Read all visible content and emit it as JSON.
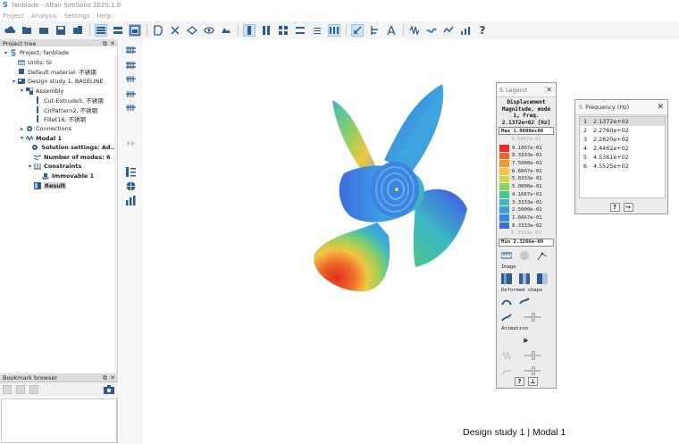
{
  "window": {
    "title": "fanblade - Altair SimSolid 2020.1.0"
  },
  "menu": [
    "Project",
    "Analysis",
    "Settings",
    "Help"
  ],
  "project_tree": {
    "title": "Project tree",
    "items": [
      {
        "label": "Project: fanblade",
        "level": 0,
        "arrow": "▾",
        "icon": "simsolid-icon",
        "bold": false
      },
      {
        "label": "Units: SI",
        "level": 1,
        "arrow": "",
        "icon": "units-icon",
        "bold": false
      },
      {
        "label": "Default material: 不锈钢",
        "level": 1,
        "arrow": "",
        "icon": "material-icon",
        "bold": false
      },
      {
        "label": "Design study 1, BASELINE",
        "level": 1,
        "arrow": "▾",
        "icon": "design-study-icon",
        "bold": false
      },
      {
        "label": "Assembly",
        "level": 2,
        "arrow": "▾",
        "icon": "assembly-icon",
        "bold": false
      },
      {
        "label": "Cut-Extrude5, 不锈钢",
        "level": 3,
        "arrow": "",
        "icon": "part-icon",
        "bold": false
      },
      {
        "label": "CirPattern2, 不锈钢",
        "level": 3,
        "arrow": "",
        "icon": "part-icon",
        "bold": false
      },
      {
        "label": "Fillet16, 不锈钢",
        "level": 3,
        "arrow": "",
        "icon": "part-icon",
        "bold": false
      },
      {
        "label": "Connections",
        "level": 2,
        "arrow": "▸",
        "icon": "connections-icon",
        "bold": false
      },
      {
        "label": "Modal 1",
        "level": 2,
        "arrow": "▾",
        "icon": "modal-icon",
        "bold": true
      },
      {
        "label": "Solution settings: Ad...",
        "level": 3,
        "arrow": "",
        "icon": "gear-icon",
        "bold": true
      },
      {
        "label": "Number of modes: 6",
        "level": 3,
        "arrow": "",
        "icon": "modes-icon",
        "bold": true
      },
      {
        "label": "Constraints",
        "level": 3,
        "arrow": "▾",
        "icon": "constraints-icon",
        "bold": true
      },
      {
        "label": "Immovable 1",
        "level": 4,
        "arrow": "",
        "icon": "immovable-icon",
        "bold": true
      },
      {
        "label": "Result",
        "level": 3,
        "arrow": "",
        "icon": "result-icon",
        "bold": true,
        "selected": true
      }
    ]
  },
  "bookmark": {
    "title": "Bookmark browser"
  },
  "legend": {
    "title": "Legend",
    "heading": [
      "Displacement",
      "Magnitude, mode",
      "1, Freq.",
      "2.1372e+02 [Hz]"
    ],
    "max_label": "Max 1.0000e+00",
    "top_faint": "9.1667e-01",
    "bands": [
      {
        "value": "9.1667e-01",
        "color": "#e52b22"
      },
      {
        "value": "8.3333e-01",
        "color": "#ee6a2a"
      },
      {
        "value": "7.5000e-01",
        "color": "#f39a36"
      },
      {
        "value": "6.6667e-01",
        "color": "#f2c543"
      },
      {
        "value": "5.8333e-01",
        "color": "#cfd84a"
      },
      {
        "value": "5.0000e-01",
        "color": "#8ed161"
      },
      {
        "value": "4.1667e-01",
        "color": "#4dc58f"
      },
      {
        "value": "3.3333e-01",
        "color": "#3db9c2"
      },
      {
        "value": "2.5000e-01",
        "color": "#3a9ee0"
      },
      {
        "value": "1.6667e-01",
        "color": "#3d84e2"
      },
      {
        "value": "8.3333e-02",
        "color": "#3f6ce0"
      }
    ],
    "bottom_faint": "8.3333e-02",
    "min_label": "Min 2.3266e-09",
    "sections": {
      "image": "Image",
      "deformed": "Deformed shape",
      "animation": "Animation"
    }
  },
  "frequency": {
    "title": "Frequency (Hz)",
    "rows": [
      {
        "n": "1",
        "value": "2.1372e+02"
      },
      {
        "n": "2",
        "value": "2.2760e+02"
      },
      {
        "n": "3",
        "value": "2.2820e+02"
      },
      {
        "n": "4",
        "value": "2.4462e+02"
      },
      {
        "n": "5",
        "value": "4.5361e+02"
      },
      {
        "n": "6",
        "value": "4.5525e+02"
      }
    ]
  },
  "status": "Design study 1 | Modal 1"
}
